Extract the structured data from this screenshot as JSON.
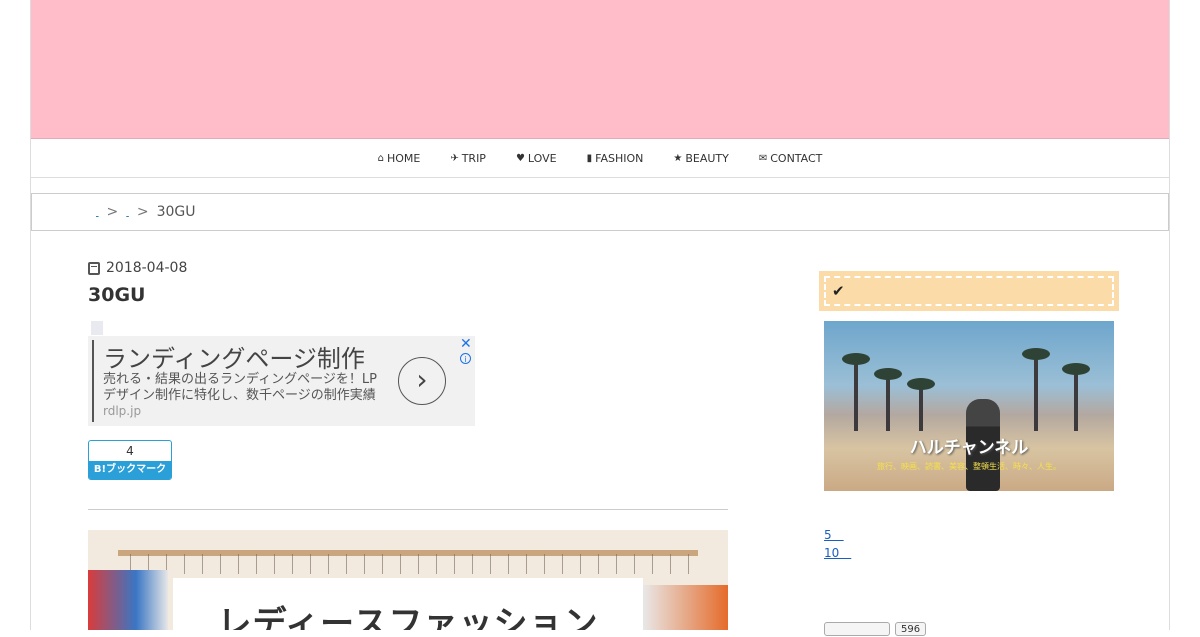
{
  "nav": {
    "items": [
      {
        "icon": "home-icon",
        "glyph": "⌂",
        "label": "HOME"
      },
      {
        "icon": "plane-icon",
        "glyph": "✈",
        "label": "TRIP"
      },
      {
        "icon": "heart-icon",
        "glyph": "♥",
        "label": "LOVE"
      },
      {
        "icon": "shirt-icon",
        "glyph": "▮",
        "label": "FASHION"
      },
      {
        "icon": "star-icon",
        "glyph": "★",
        "label": "BEAUTY"
      },
      {
        "icon": "envelope-icon",
        "glyph": "✉",
        "label": "CONTACT"
      }
    ]
  },
  "breadcrumb": {
    "link1": " ",
    "link2": " ",
    "separator": ">",
    "current": "30GU"
  },
  "post": {
    "date": "2018-04-08",
    "title": "30GU"
  },
  "ad": {
    "headline": "ランディングページ制作",
    "description": "売れる・結果の出るランディングページを！LPデザイン制作に特化し、数千ページの制作実績",
    "url": "rdlp.jp",
    "arrow": "›",
    "close": "✕",
    "info": "i"
  },
  "hatena": {
    "count": "4",
    "label": "B!ブックマーク"
  },
  "hero": {
    "text": "レディースファッション"
  },
  "sidebar": {
    "banner_title": "ハルチャンネル",
    "banner_subtitle": "旅行、映画、読書、美容、整頓生活、時々、人生。",
    "links": [
      "5　",
      "10　"
    ],
    "count": "596"
  },
  "colors": {
    "header": "#ffbcc9",
    "sidebar_heading": "#fbdca8",
    "hatena_blue": "#2a9fd8"
  }
}
